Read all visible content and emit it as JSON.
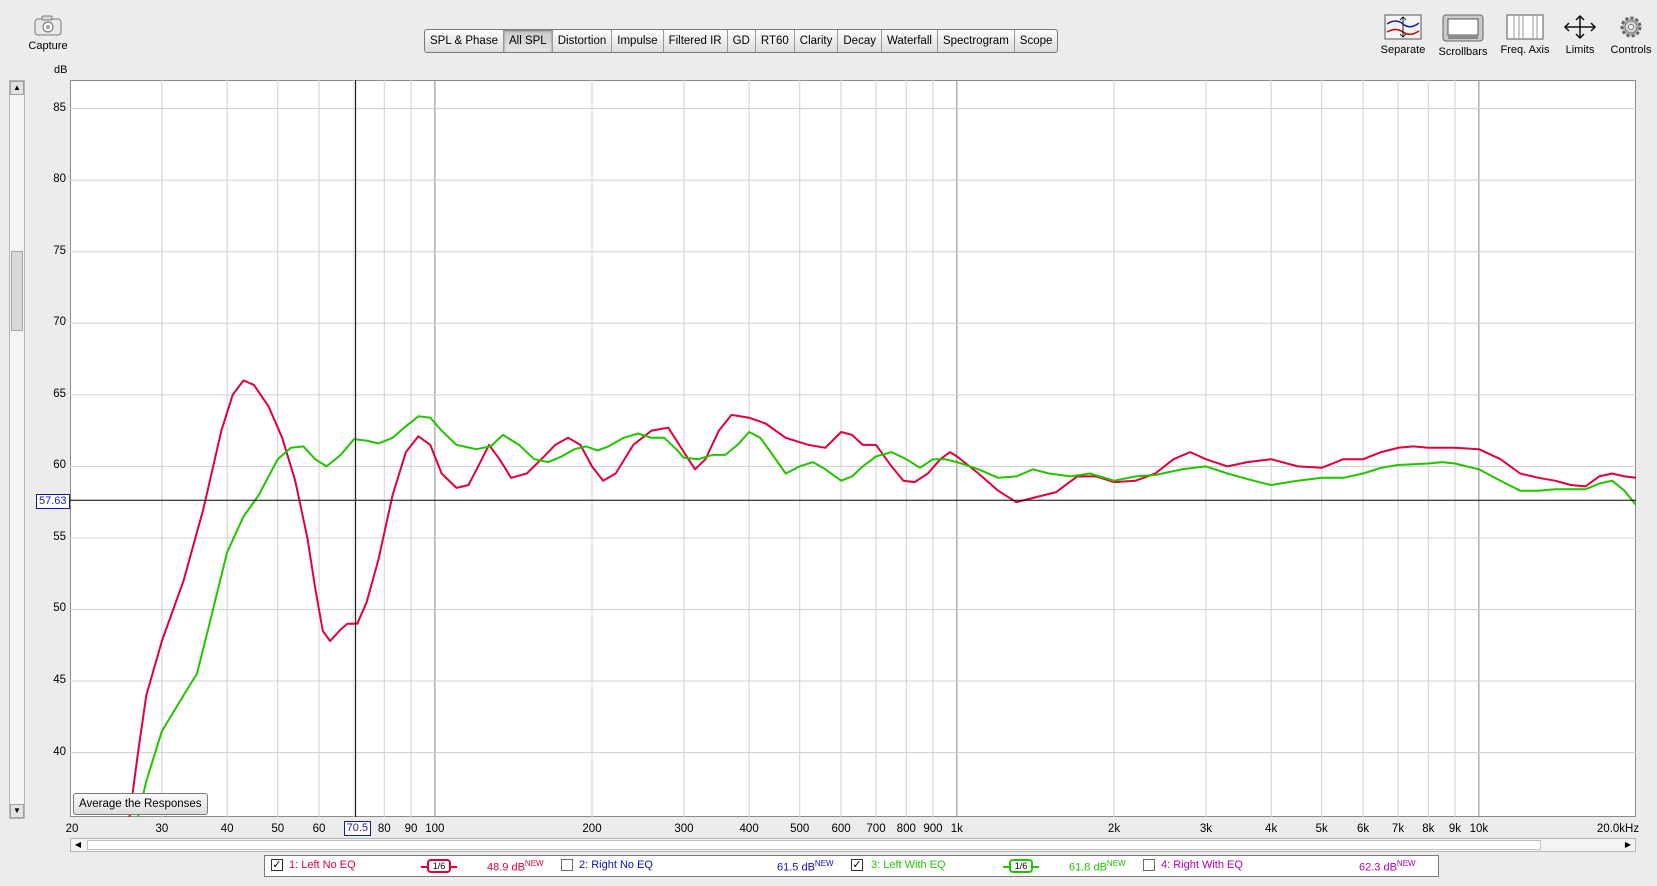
{
  "capture": {
    "label": "Capture"
  },
  "tabs": [
    {
      "label": "SPL & Phase"
    },
    {
      "label": "All SPL",
      "active": true
    },
    {
      "label": "Distortion"
    },
    {
      "label": "Impulse"
    },
    {
      "label": "Filtered IR"
    },
    {
      "label": "GD"
    },
    {
      "label": "RT60"
    },
    {
      "label": "Clarity"
    },
    {
      "label": "Decay"
    },
    {
      "label": "Waterfall"
    },
    {
      "label": "Spectrogram"
    },
    {
      "label": "Scope"
    }
  ],
  "toolbar": {
    "separate": "Separate",
    "scrollbars": "Scrollbars",
    "freq_axis": "Freq. Axis",
    "limits": "Limits",
    "controls": "Controls"
  },
  "cursor": {
    "y_value": "57.63",
    "x_value": "70.5"
  },
  "average_button": "Average the Responses",
  "legend": [
    {
      "index": "1: Left No EQ",
      "checked": true,
      "color": "#e0003c",
      "smoothing": "1/6",
      "level": "48.9 dB",
      "tag": "NEW"
    },
    {
      "index": "2: Right No EQ",
      "checked": false,
      "color": "#1010b0",
      "smoothing": "",
      "level": "61.5 dB",
      "tag": "NEW"
    },
    {
      "index": "3: Left With EQ",
      "checked": true,
      "color": "#22c400",
      "smoothing": "1/6",
      "level": "61.8 dB",
      "tag": "NEW"
    },
    {
      "index": "4: Right With EQ",
      "checked": false,
      "color": "#b000b0",
      "smoothing": "",
      "level": "62.3 dB",
      "tag": "NEW"
    }
  ],
  "chart_data": {
    "type": "line",
    "ylabel": "dB",
    "xlabel": "",
    "x_scale": "log",
    "xlim": [
      20,
      20000
    ],
    "ylim": [
      35.5,
      87
    ],
    "x_tick_labels": [
      "20",
      "30",
      "40",
      "50",
      "60",
      "70.5",
      "80",
      "90",
      "100",
      "200",
      "300",
      "400",
      "500",
      "600",
      "700",
      "800",
      "900",
      "1k",
      "2k",
      "3k",
      "4k",
      "5k",
      "6k",
      "7k",
      "8k",
      "9k",
      "10k",
      "20.0kHz"
    ],
    "y_tick_labels": [
      "85",
      "80",
      "75",
      "70",
      "65",
      "60",
      "55",
      "50",
      "45",
      "40"
    ],
    "y_ticks": [
      85,
      80,
      75,
      70,
      65,
      60,
      55,
      50,
      45,
      40
    ],
    "cursor": {
      "x": 70.5,
      "y": 57.63
    },
    "series": [
      {
        "name": "1: Left No EQ",
        "color": "#e0003c",
        "points": [
          [
            26,
            35.5
          ],
          [
            27,
            40
          ],
          [
            28,
            44
          ],
          [
            30,
            47.8
          ],
          [
            33,
            52
          ],
          [
            36,
            57
          ],
          [
            39,
            62.5
          ],
          [
            41,
            65
          ],
          [
            43,
            66
          ],
          [
            45,
            65.7
          ],
          [
            48,
            64.2
          ],
          [
            51,
            62
          ],
          [
            54,
            59
          ],
          [
            57,
            55
          ],
          [
            59,
            51.5
          ],
          [
            61,
            48.5
          ],
          [
            63,
            47.8
          ],
          [
            66,
            48.6
          ],
          [
            68,
            49
          ],
          [
            71,
            49
          ],
          [
            74,
            50.5
          ],
          [
            78,
            53.5
          ],
          [
            83,
            58
          ],
          [
            88,
            61
          ],
          [
            93,
            62.1
          ],
          [
            98,
            61.5
          ],
          [
            103,
            59.5
          ],
          [
            110,
            58.5
          ],
          [
            116,
            58.7
          ],
          [
            121,
            60
          ],
          [
            127,
            61.5
          ],
          [
            133,
            60.5
          ],
          [
            140,
            59.2
          ],
          [
            150,
            59.5
          ],
          [
            160,
            60.5
          ],
          [
            170,
            61.5
          ],
          [
            180,
            62
          ],
          [
            190,
            61.5
          ],
          [
            200,
            60
          ],
          [
            210,
            59
          ],
          [
            222,
            59.5
          ],
          [
            240,
            61.5
          ],
          [
            260,
            62.5
          ],
          [
            280,
            62.7
          ],
          [
            300,
            61
          ],
          [
            315,
            59.8
          ],
          [
            330,
            60.5
          ],
          [
            350,
            62.5
          ],
          [
            370,
            63.6
          ],
          [
            400,
            63.4
          ],
          [
            430,
            63
          ],
          [
            470,
            62
          ],
          [
            520,
            61.5
          ],
          [
            560,
            61.3
          ],
          [
            600,
            62.4
          ],
          [
            630,
            62.2
          ],
          [
            660,
            61.5
          ],
          [
            700,
            61.5
          ],
          [
            750,
            60
          ],
          [
            790,
            59
          ],
          [
            830,
            58.9
          ],
          [
            880,
            59.5
          ],
          [
            930,
            60.5
          ],
          [
            970,
            61
          ],
          [
            1000,
            60.7
          ],
          [
            1100,
            59.5
          ],
          [
            1200,
            58.3
          ],
          [
            1300,
            57.5
          ],
          [
            1400,
            57.8
          ],
          [
            1550,
            58.2
          ],
          [
            1700,
            59.3
          ],
          [
            1850,
            59.3
          ],
          [
            2000,
            58.9
          ],
          [
            2200,
            59
          ],
          [
            2400,
            59.5
          ],
          [
            2600,
            60.5
          ],
          [
            2800,
            61
          ],
          [
            3000,
            60.5
          ],
          [
            3300,
            60
          ],
          [
            3600,
            60.3
          ],
          [
            4000,
            60.5
          ],
          [
            4500,
            60
          ],
          [
            5000,
            59.9
          ],
          [
            5500,
            60.5
          ],
          [
            6000,
            60.5
          ],
          [
            6500,
            61
          ],
          [
            7000,
            61.3
          ],
          [
            7500,
            61.4
          ],
          [
            8000,
            61.3
          ],
          [
            8500,
            61.3
          ],
          [
            9000,
            61.3
          ],
          [
            10000,
            61.2
          ],
          [
            11000,
            60.5
          ],
          [
            12000,
            59.5
          ],
          [
            13000,
            59.2
          ],
          [
            14000,
            59
          ],
          [
            15000,
            58.7
          ],
          [
            16000,
            58.6
          ],
          [
            17000,
            59.3
          ],
          [
            18000,
            59.5
          ],
          [
            19000,
            59.3
          ],
          [
            20000,
            59.2
          ]
        ]
      },
      {
        "name": "3: Left With EQ",
        "color": "#22c400",
        "points": [
          [
            27,
            35.5
          ],
          [
            28,
            38
          ],
          [
            30,
            41.5
          ],
          [
            33,
            44
          ],
          [
            35,
            45.5
          ],
          [
            37,
            49
          ],
          [
            40,
            54
          ],
          [
            43,
            56.5
          ],
          [
            46,
            58
          ],
          [
            50,
            60.5
          ],
          [
            53,
            61.3
          ],
          [
            56,
            61.4
          ],
          [
            59,
            60.5
          ],
          [
            62,
            60
          ],
          [
            66,
            60.8
          ],
          [
            70,
            61.9
          ],
          [
            74,
            61.8
          ],
          [
            78,
            61.6
          ],
          [
            83,
            62
          ],
          [
            88,
            62.8
          ],
          [
            93,
            63.5
          ],
          [
            98,
            63.4
          ],
          [
            103,
            62.5
          ],
          [
            110,
            61.5
          ],
          [
            120,
            61.2
          ],
          [
            128,
            61.4
          ],
          [
            135,
            62.2
          ],
          [
            145,
            61.5
          ],
          [
            155,
            60.5
          ],
          [
            165,
            60.3
          ],
          [
            175,
            60.7
          ],
          [
            185,
            61.2
          ],
          [
            195,
            61.4
          ],
          [
            205,
            61.1
          ],
          [
            215,
            61.4
          ],
          [
            230,
            62
          ],
          [
            245,
            62.3
          ],
          [
            260,
            62
          ],
          [
            275,
            62
          ],
          [
            290,
            61.2
          ],
          [
            300,
            60.6
          ],
          [
            320,
            60.5
          ],
          [
            340,
            60.8
          ],
          [
            360,
            60.8
          ],
          [
            380,
            61.5
          ],
          [
            400,
            62.4
          ],
          [
            420,
            62
          ],
          [
            440,
            61
          ],
          [
            470,
            59.5
          ],
          [
            500,
            60
          ],
          [
            530,
            60.3
          ],
          [
            560,
            59.8
          ],
          [
            600,
            59
          ],
          [
            630,
            59.3
          ],
          [
            660,
            60
          ],
          [
            700,
            60.7
          ],
          [
            750,
            61
          ],
          [
            800,
            60.5
          ],
          [
            850,
            59.9
          ],
          [
            900,
            60.5
          ],
          [
            950,
            60.5
          ],
          [
            1000,
            60.3
          ],
          [
            1100,
            59.8
          ],
          [
            1200,
            59.2
          ],
          [
            1300,
            59.3
          ],
          [
            1400,
            59.8
          ],
          [
            1500,
            59.5
          ],
          [
            1650,
            59.3
          ],
          [
            1800,
            59.5
          ],
          [
            2000,
            59
          ],
          [
            2200,
            59.3
          ],
          [
            2400,
            59.4
          ],
          [
            2700,
            59.8
          ],
          [
            3000,
            60
          ],
          [
            3300,
            59.5
          ],
          [
            3700,
            59
          ],
          [
            4000,
            58.7
          ],
          [
            4500,
            59
          ],
          [
            5000,
            59.2
          ],
          [
            5500,
            59.2
          ],
          [
            6000,
            59.5
          ],
          [
            6500,
            59.9
          ],
          [
            7000,
            60.1
          ],
          [
            8000,
            60.2
          ],
          [
            8500,
            60.3
          ],
          [
            9000,
            60.2
          ],
          [
            10000,
            59.8
          ],
          [
            11000,
            59
          ],
          [
            12000,
            58.3
          ],
          [
            13000,
            58.3
          ],
          [
            14000,
            58.4
          ],
          [
            15000,
            58.4
          ],
          [
            16000,
            58.4
          ],
          [
            17000,
            58.8
          ],
          [
            18000,
            59
          ],
          [
            19000,
            58.3
          ],
          [
            20000,
            57.3
          ]
        ]
      }
    ]
  }
}
